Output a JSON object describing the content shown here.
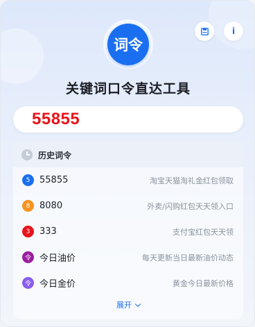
{
  "header": {
    "logo_text": "词令",
    "title": "关键词口令直达工具",
    "save_icon": "save-icon",
    "info_label": "i"
  },
  "search": {
    "value": "55855"
  },
  "history": {
    "title": "历史词令",
    "items": [
      {
        "badge": "5",
        "badge_color": "#1a6ff0",
        "code": "55855",
        "desc": "淘宝天猫淘礼金红包领取"
      },
      {
        "badge": "8",
        "badge_color": "#f7931e",
        "code": "8080",
        "desc": "外卖/闪购红包天天领入口"
      },
      {
        "badge": "3",
        "badge_color": "#e8141b",
        "code": "333",
        "desc": "支付宝红包天天领"
      },
      {
        "badge": "令",
        "badge_color": "#9a1ea0",
        "code": "今日油价",
        "desc": "每天更新当日最新油价动态"
      },
      {
        "badge": "令",
        "badge_color": "#8a5cf0",
        "code": "今日金价",
        "desc": "黄金今日最新价格"
      }
    ],
    "expand_label": "展开"
  },
  "colors": {
    "accent": "#1a6ff0",
    "highlight": "#e8141b"
  }
}
